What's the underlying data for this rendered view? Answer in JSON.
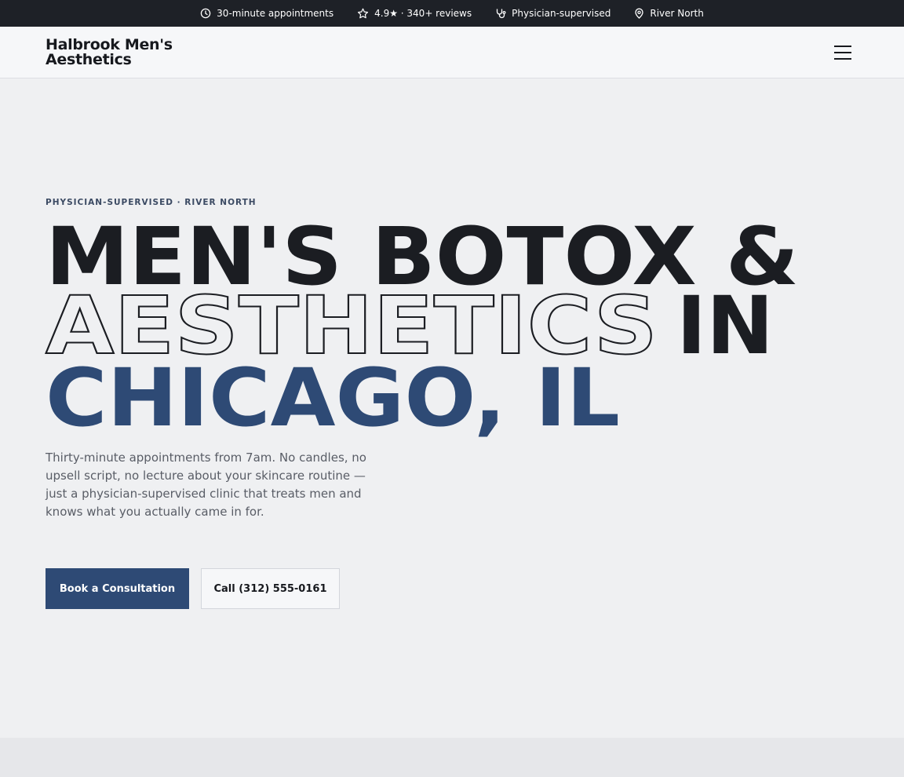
{
  "topbar": {
    "items": [
      {
        "icon": "clock-icon",
        "label": "30-minute appointments"
      },
      {
        "icon": "star-icon",
        "label": "4.9★ · 340+ reviews"
      },
      {
        "icon": "stethoscope-icon",
        "label": "Physician-supervised"
      },
      {
        "icon": "map-pin-icon",
        "label": "River North"
      }
    ]
  },
  "header": {
    "logo_line1": "Halbrook Men's",
    "logo_line2": "Aesthetics",
    "menu_icon": "hamburger-menu-icon"
  },
  "hero": {
    "eyebrow": "PHYSICIAN-SUPERVISED · RIVER NORTH",
    "headline_line1": "MEN'S BOTOX &",
    "headline_line2_outline": "AESTHETICS",
    "headline_line2_solid": "IN",
    "headline_line3": "CHICAGO, IL",
    "lead": "Thirty-minute appointments from 7am. No candles, no upsell script, no lecture about your skincare routine — just a physician-supervised clinic that treats men and knows what you actually came in for.",
    "primary_cta": "Book a Consultation",
    "secondary_cta": "Call (312) 555-0161"
  },
  "colors": {
    "accent": "#2e4a75",
    "topbar_bg": "#1e2127",
    "page_bg": "#eff0f2",
    "ink": "#1b1d22"
  }
}
